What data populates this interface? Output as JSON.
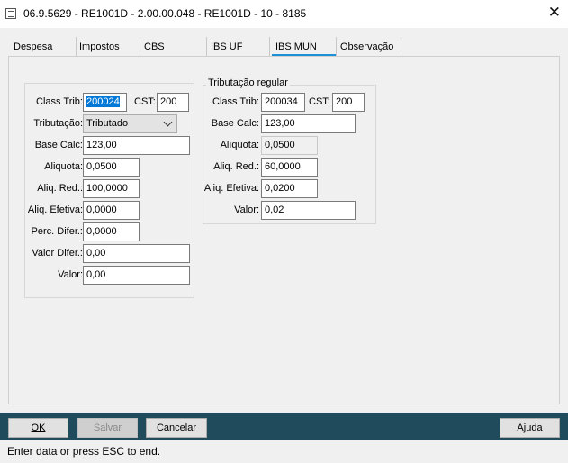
{
  "window": {
    "title": "06.9.5629 - RE1001D - 2.00.00.048 - RE1001D - 10 - 8185",
    "close_label": "✕"
  },
  "tabs": [
    {
      "label": "Despesa"
    },
    {
      "label": "Impostos"
    },
    {
      "label": "CBS"
    },
    {
      "label": "IBS UF"
    },
    {
      "label": "IBS MUN"
    },
    {
      "label": "Observação"
    }
  ],
  "active_tab": "IBS MUN",
  "accent_color": "#1e90d6",
  "left_panel": {
    "class_trib_label": "Class Trib:",
    "class_trib_value": "200024",
    "cst_label": "CST:",
    "cst_value": "200",
    "tributacao_label": "Tributação:",
    "tributacao_value": "Tributado",
    "base_calc_label": "Base Calc:",
    "base_calc_value": "123,00",
    "aliquota_label": "Aliquota:",
    "aliquota_value": "0,0500",
    "aliq_red_label": "Aliq. Red.:",
    "aliq_red_value": "100,0000",
    "aliq_efetiva_label": "Aliq. Efetiva:",
    "aliq_efetiva_value": "0,0000",
    "perc_difer_label": "Perc. Difer.:",
    "perc_difer_value": "0,0000",
    "valor_difer_label": "Valor Difer.:",
    "valor_difer_value": "0,00",
    "valor_label": "Valor:",
    "valor_value": "0,00"
  },
  "right_panel": {
    "legend": "Tributação regular",
    "class_trib_label": "Class Trib:",
    "class_trib_value": "200034",
    "cst_label": "CST:",
    "cst_value": "200",
    "base_calc_label": "Base Calc:",
    "base_calc_value": "123,00",
    "aliquota_label": "Alíquota:",
    "aliquota_value": "0,0500",
    "aliq_red_label": "Aliq. Red.:",
    "aliq_red_value": "60,0000",
    "aliq_efetiva_label": "Aliq. Efetiva:",
    "aliq_efetiva_value": "0,0200",
    "valor_label": "Valor:",
    "valor_value": "0,02"
  },
  "footer": {
    "ok_label": "OK",
    "salvar_label": "Salvar",
    "cancelar_label": "Cancelar",
    "ajuda_label": "Ajuda",
    "background": "#1f4b5c"
  },
  "status": {
    "text": "Enter data or press ESC to end."
  }
}
